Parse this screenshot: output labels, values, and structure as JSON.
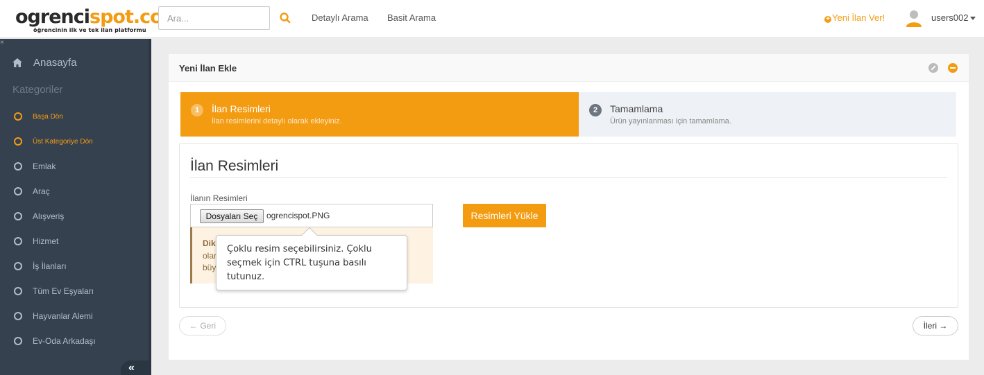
{
  "header": {
    "logo_part1": "ogrenci",
    "logo_part2": "spot.com",
    "logo_tagline": "öğrencinin ilk ve tek ilan platformu",
    "search_placeholder": "Ara...",
    "search_icon": "search-icon",
    "nav": [
      "Detaylı Arama",
      "Basit Arama"
    ],
    "new_ad_label": "Yeni İlan Ver!",
    "username": "users002",
    "accent_color": "#f39c12"
  },
  "sidebar": {
    "close_mark": "×",
    "home_label": "Anasayfa",
    "heading": "Kategoriler",
    "items": [
      {
        "label": "Başa Dön",
        "active": true
      },
      {
        "label": "Üst Kategoriye Dön",
        "active": true
      },
      {
        "label": "Emlak",
        "active": false
      },
      {
        "label": "Araç",
        "active": false
      },
      {
        "label": "Alışveriş",
        "active": false
      },
      {
        "label": "Hizmet",
        "active": false
      },
      {
        "label": "İş İlanları",
        "active": false
      },
      {
        "label": "Tüm Ev Eşyaları",
        "active": false
      },
      {
        "label": "Hayvanlar Alemi",
        "active": false
      },
      {
        "label": "Ev-Oda Arkadaşı",
        "active": false
      }
    ],
    "toggle_label": "«"
  },
  "portlet": {
    "title": "Yeni İlan Ekle"
  },
  "steps": [
    {
      "num": "1",
      "title": "İlan Resimleri",
      "desc": "İlan resimlerini detaylı olarak ekleyiniz."
    },
    {
      "num": "2",
      "title": "Tamamlama",
      "desc": "Ürün yayınlanması için tamamlama."
    }
  ],
  "form": {
    "section_title": "İlan Resimleri",
    "field_label": "İlanın Resimleri",
    "file_button": "Dosyaları Seç",
    "file_name": "ogrencispot.PNG",
    "upload_button": "Resimleri Yükle",
    "note_line1": "Dik",
    "note_line2": "olar",
    "note_line3": "büy"
  },
  "tooltip": {
    "text": "Çoklu resim seçebilirsiniz. Çoklu seçmek için CTRL tuşuna basılı tutunuz."
  },
  "nav_buttons": {
    "back": "← Geri",
    "next": "İleri →"
  }
}
